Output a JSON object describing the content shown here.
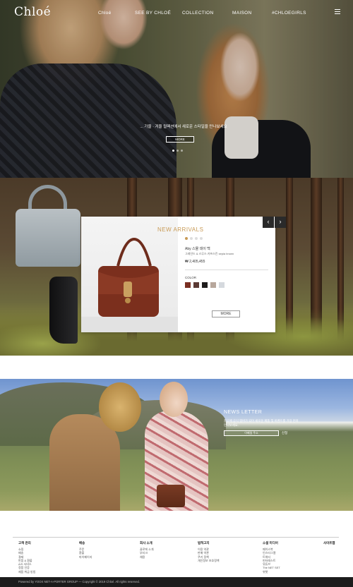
{
  "header": {
    "logo": "Chloé",
    "nav": [
      "Chloé",
      "SEE BY CHLOÉ",
      "COLLECTION",
      "MAISON",
      "#CHLOEGIRLS"
    ]
  },
  "hero": {
    "caption": "... 가을 · 겨울 컬렉션에서 새로운 스타일을 만나보세요",
    "button": "MORE"
  },
  "arrivals": {
    "title": "NEW ARRIVALS",
    "product_name": "Aby 스몰 데이 백",
    "product_sub": "그레인드 & 스무스 카프스킨 sepia brown",
    "price": "₩ 2,405,455",
    "color_label": "COLOR",
    "colors": [
      "#7a2f22",
      "#5b3a34",
      "#1e1c1c",
      "#b7a79c",
      "#d5d9de"
    ],
    "more": "MORE",
    "prev": "‹",
    "next": "›"
  },
  "newsletter": {
    "title": "NEWS LETTER",
    "desc": "끌로에 공식 멤버가 되어 새로운 제품 및 이벤트를 가장 먼저 만나보세요.",
    "placeholder": "이메일 주소",
    "submit": "신청"
  },
  "footer": {
    "columns": [
      {
        "title": "고객 관리",
        "items": [
          "쇼핑",
          "배송",
          "결제",
          "반품 & 환불",
          "A/S 서비스",
          "정품 인증",
          "제품 취급 방법"
        ]
      },
      {
        "title": "배송",
        "items": [
          "주문",
          "환불",
          "마이페이지"
        ]
      },
      {
        "title": "회사 소개",
        "items": [
          "끌로에 소개",
          "부티크",
          "채용"
        ]
      },
      {
        "title": "법적고지",
        "items": [
          "이용 약관",
          "판매 약관",
          "쿠키 정책",
          "개인정보 보호정책"
        ]
      },
      {
        "title": "소셜 미디어",
        "items": [
          "페이스북",
          "인스타그램",
          "트위터",
          "핀터레스트",
          "유튜브",
          "The NET SET",
          "위챗"
        ]
      },
      {
        "title": "사이트맵",
        "items": []
      }
    ],
    "copyright": "Powered by YOOX NET-A-PORTER GROUP — Copyright © 2019 Chloé. All rights reserved."
  }
}
